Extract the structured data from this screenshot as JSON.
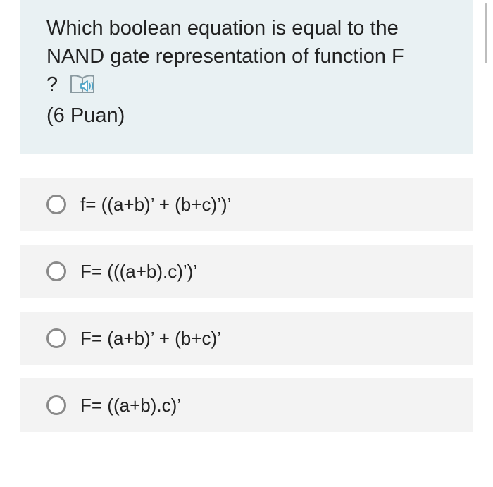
{
  "question": {
    "text": "Which boolean equation is equal to the NAND gate representation of function F",
    "tail": "?",
    "points": "(6 Puan)",
    "reader_icon": "immersive-reader-icon"
  },
  "options": [
    {
      "label": "f= ((a+b)’ + (b+c)’)’",
      "selected": false
    },
    {
      "label": "F= (((a+b).c)’)’",
      "selected": false
    },
    {
      "label": "F= (a+b)’ + (b+c)’",
      "selected": false
    },
    {
      "label": "F= ((a+b).c)’",
      "selected": false
    }
  ],
  "colors": {
    "question_bg": "#e9f1f3",
    "option_bg": "#f3f3f3",
    "radio_border": "#8a8a8a",
    "text": "#222222"
  }
}
